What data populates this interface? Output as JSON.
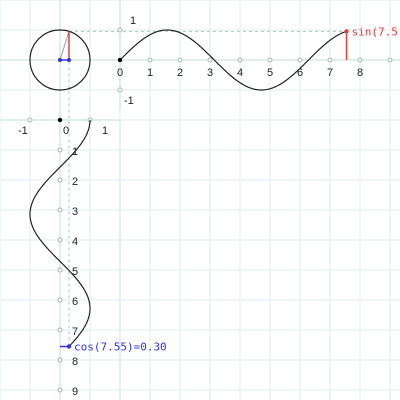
{
  "chart_data": {
    "type": "line",
    "theta": 7.55,
    "sin_label": "sin(7.5",
    "cos_label": "cos(7.55)=0.30",
    "top_axis": {
      "x_ticks": [
        "0",
        "1",
        "2",
        "3",
        "4",
        "5",
        "6",
        "7",
        "8"
      ],
      "y_ticks": [
        "1",
        "-1"
      ]
    },
    "side_axis": {
      "x_ticks": [
        "-1",
        "0",
        "1"
      ],
      "y_ticks": [
        "1",
        "2",
        "3",
        "4",
        "5",
        "6",
        "7",
        "8",
        "9"
      ]
    },
    "series": [
      {
        "values": "sin(t) for t in [0, 7.55]"
      },
      {
        "values": "cos(t) for t in [0, 7.55]"
      }
    ]
  },
  "colors": {
    "grid": "#e2eeee",
    "grid_dash": "#a8c8c0",
    "curve": "#222222",
    "sin_marker": "#e04040",
    "cos_marker": "#3333dd",
    "radius": "#9a9a9a",
    "origin_dot": "#000000"
  }
}
